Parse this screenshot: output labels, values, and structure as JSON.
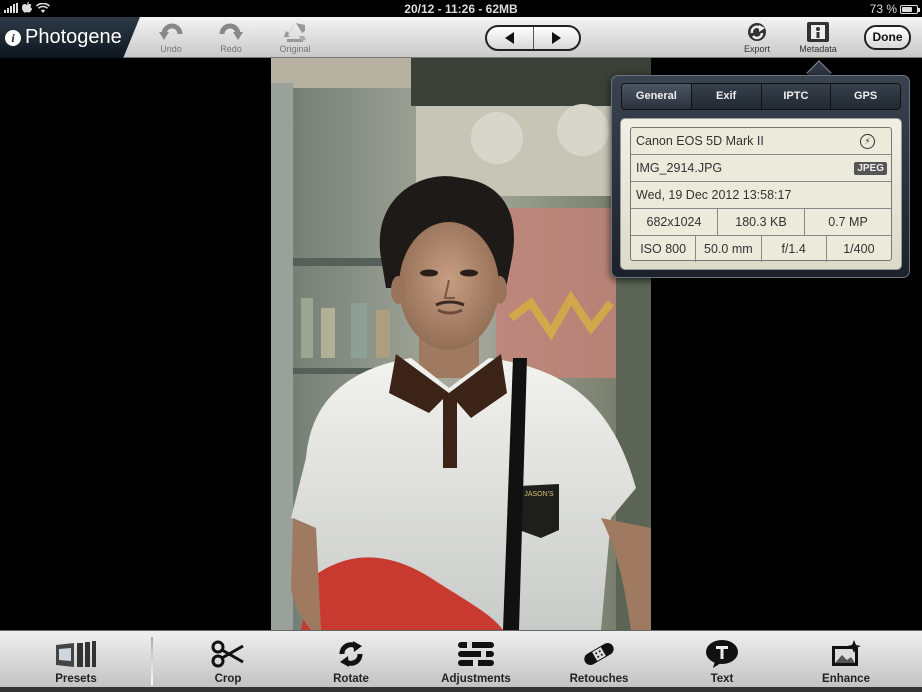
{
  "status": {
    "datetime": "20/12 - 11:26 - 62MB",
    "battery_text": "73 %",
    "battery_level": 0.73
  },
  "app": {
    "title": "Photogene"
  },
  "toolbar": {
    "undo_label": "Undo",
    "redo_label": "Redo",
    "original_label": "Original",
    "export_label": "Export",
    "metadata_label": "Metadata",
    "done_label": "Done"
  },
  "metadata": {
    "tabs": [
      "General",
      "Exif",
      "IPTC",
      "GPS"
    ],
    "active_tab": "General",
    "camera": "Canon EOS 5D Mark II",
    "filename": "IMG_2914.JPG",
    "format_badge": "JPEG",
    "date": "Wed, 19 Dec 2012 13:58:17",
    "dimensions": "682x1024",
    "filesize": "180.3 KB",
    "megapixels": "0.7 MP",
    "iso": "ISO 800",
    "focal_length": "50.0 mm",
    "aperture": "f/1.4",
    "shutter": "1/400"
  },
  "bottom": {
    "presets": "Presets",
    "crop": "Crop",
    "rotate": "Rotate",
    "adjustments": "Adjustments",
    "retouches": "Retouches",
    "text": "Text",
    "enhance": "Enhance"
  },
  "colors": {
    "accent_blue": "#1e6fb0",
    "popover_bg": "#2a323c",
    "panel_bg": "#ebeadb"
  }
}
